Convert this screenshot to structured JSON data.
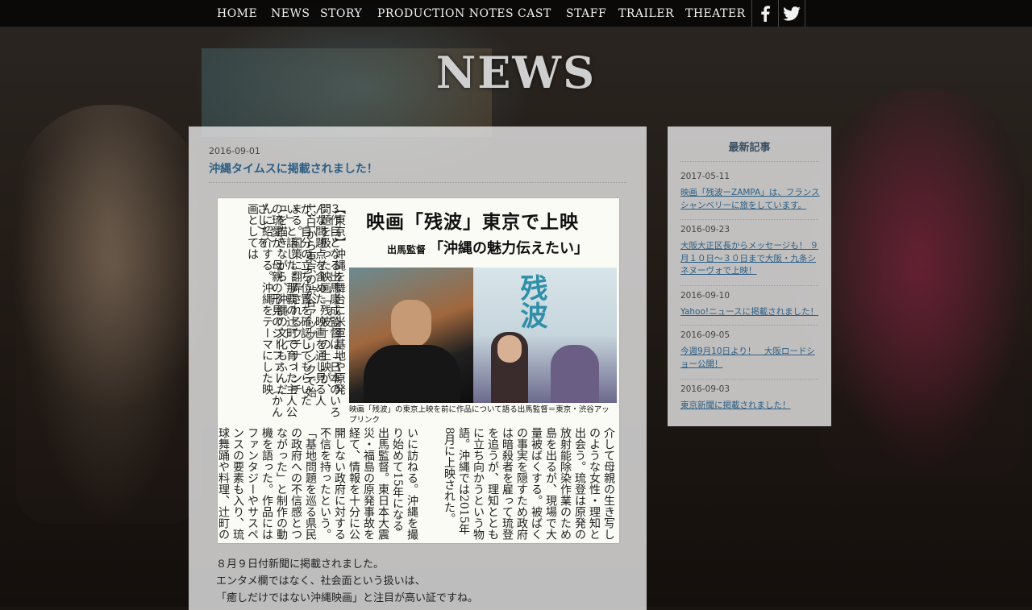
{
  "nav": {
    "items": [
      "HOME",
      "NEWS",
      "STORY",
      "PRODUCTION NOTES",
      "CAST",
      "STAFF",
      "TRAILER",
      "THEATER"
    ],
    "social": [
      "facebook-icon",
      "twitter-icon"
    ]
  },
  "page_heading": "NEWS",
  "post": {
    "date": "2016-09-01",
    "title": "沖縄タイムスに掲載されました！",
    "body_lines": [
      "８月９日付新聞に掲載されました。",
      "エンタメ欄ではなく、社会面という扱いは、",
      "「癒しだけではない沖縄映画」と注目が高い証ですね。"
    ]
  },
  "clipping": {
    "headline": "映画「残波」東京で上映",
    "sub_prefix": "出馬監督",
    "sub_quote": "「沖縄の魅力伝えたい」",
    "poster_title": "残波",
    "caption": "映画「残波」の東京上映を前に作品について語る出馬監督＝東京・渋谷アップリンク",
    "col_right_top": "【東京】沖縄を舞台に米軍基地や原発問題を扱った映画「残波」の上映が、13日から東京の渋谷アップリンクで始まる。国策に翻弄されるウチナーンチュを描きながら、沖縄の文化もふんだんに紹介する。沖縄をテーマにした映画としては",
    "col_mid_top": "３作目となる出馬康成監督は「日本のいろんな問題点を含めた。映画を通し見る人が、自分の立ち位置を確認してもらいたい」と話した。那覇の辻町で育った主人公の琉愛が、母親の形見のジーファー（かんざし）を",
    "col_left_bottom": "いに訪ねる。沖縄を撮り始めて15年になる出馬監督。東日本大震災・福島の原発事故を経て、情報を十分に公開しない政府に対する不信を持ったという。「基地問題を巡る県民の政府への不信感とつながった」と制作の動機を語った。作品にはファンタジーやサスペンスの要素も入り、琉球舞踊や料理、辻町の文化なども登場。「沖縄の魂、精神文化も溜り込んでおり、県外の人にもディープな沖縄の魅力を伝えたい」と話した。",
    "col_right_bottom": "介して母親の生き写しのような女性・理知と出会う。琉登は原発の放射能除染作業のため島を出るが、現場で大量被ばくする。被ばくの事実を隠すため政府は暗殺者を雇って琉登を追うが、理知とともに立ち向かうという物語。沖縄では2015年8月に上映された。"
  },
  "sidebar": {
    "title": "最新記事",
    "entries": [
      {
        "date": "2017-05-11",
        "title": "映画「残波ーZAMPA」は、フランスシャンベリーに旅をしています。"
      },
      {
        "date": "2016-09-23",
        "title": "大阪大正区長からメッセージも！ ９月１０日～３０日まで大阪・九条シネヌーヴォで上映！"
      },
      {
        "date": "2016-09-10",
        "title": "Yahoo!ニュースに掲載されました！"
      },
      {
        "date": "2016-09-05",
        "title": "今週9月10日より！　大阪ロードショー公開！"
      },
      {
        "date": "2016-09-03",
        "title": "東京新聞に掲載されました！"
      }
    ]
  }
}
